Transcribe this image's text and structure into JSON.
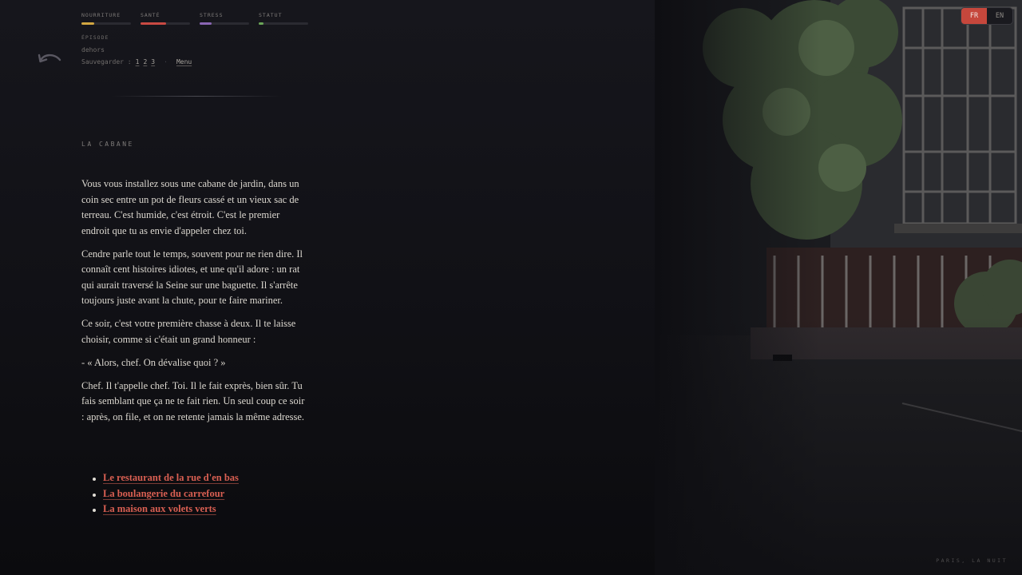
{
  "stats": [
    {
      "label": "NOURRITURE",
      "level": 0.25,
      "color": "#d2a741"
    },
    {
      "label": "SANTÉ",
      "level": 0.52,
      "color": "#c94a43"
    },
    {
      "label": "STRESS",
      "level": 0.24,
      "color": "#8a66b4"
    },
    {
      "label": "STATUT",
      "level": 0.1,
      "color": "#6aa557"
    }
  ],
  "episode": {
    "label": "ÉPISODE",
    "value": "dehors"
  },
  "save": {
    "label": "Sauvegarder :",
    "slots": [
      "1",
      "2",
      "3"
    ],
    "separator": "·",
    "menu": "Menu"
  },
  "chapter": "LA CABANE",
  "story": [
    "Vous vous installez sous une cabane de jardin, dans un coin sec entre un pot de fleurs cassé et un vieux sac de terreau. C'est humide, c'est étroit. C'est le premier endroit que tu as envie d'appeler chez toi.",
    "Cendre parle tout le temps, souvent pour ne rien dire. Il connaît cent histoires idiotes, et une qu'il adore : un rat qui aurait traversé la Seine sur une baguette. Il s'arrête toujours juste avant la chute, pour te faire mariner.",
    "Ce soir, c'est votre première chasse à deux. Il te laisse choisir, comme si c'était un grand honneur :",
    "- « Alors, chef. On dévalise quoi ? »",
    "Chef. Il t'appelle chef. Toi. Il le fait exprès, bien sûr. Tu fais semblant que ça ne te fait rien. Un seul coup ce soir : après, on file, et on ne retente jamais la même adresse."
  ],
  "choices": [
    "Le restaurant de la rue d'en bas",
    "La boulangerie du carrefour",
    "La maison aux volets verts"
  ],
  "lang": {
    "fr": "FR",
    "en": "EN",
    "active": "fr"
  },
  "footer": "PARIS, LA NUIT",
  "colors": {
    "accent": "#c6473c",
    "choice_link": "#d95f52"
  }
}
